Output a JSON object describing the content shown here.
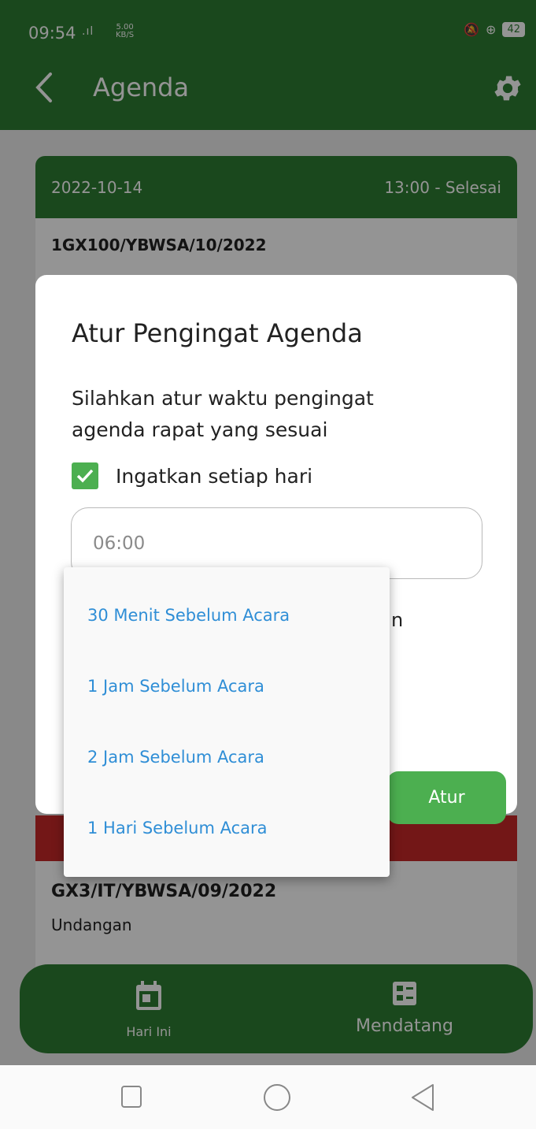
{
  "status_bar": {
    "time": "09:54",
    "signal": ".ıl",
    "speed_value": "5.00",
    "speed_unit": "KB/S",
    "battery": "42"
  },
  "appbar": {
    "title": "Agenda"
  },
  "agenda_cards": [
    {
      "date": "2022-10-14",
      "time": "13:00 - Selesai",
      "number": "1GX100/YBWSA/10/2022"
    },
    {
      "number": "GX3/IT/YBWSA/09/2022",
      "type": "Undangan"
    }
  ],
  "dialog": {
    "title": "Atur Pengingat Agenda",
    "message": "Silahkan atur waktu pengingat agenda rapat yang sesuai",
    "checkbox_label": "Ingatkan setiap hari",
    "checkbox_checked": true,
    "time_value": "06:00",
    "partial_text": "n",
    "confirm_label": "Atur"
  },
  "dropdown": {
    "options": [
      "30 Menit Sebelum Acara",
      "1 Jam Sebelum Acara",
      "2 Jam Sebelum Acara",
      "1 Hari Sebelum Acara"
    ]
  },
  "bottom_nav": {
    "items": [
      {
        "label": "Hari Ini",
        "icon": "calendar-icon"
      },
      {
        "label": "Mendatang",
        "icon": "list-grid-icon"
      }
    ]
  },
  "colors": {
    "primary": "#2e7d32",
    "accent": "#4caf50",
    "link": "#2f8ed6",
    "danger": "#c62828"
  }
}
